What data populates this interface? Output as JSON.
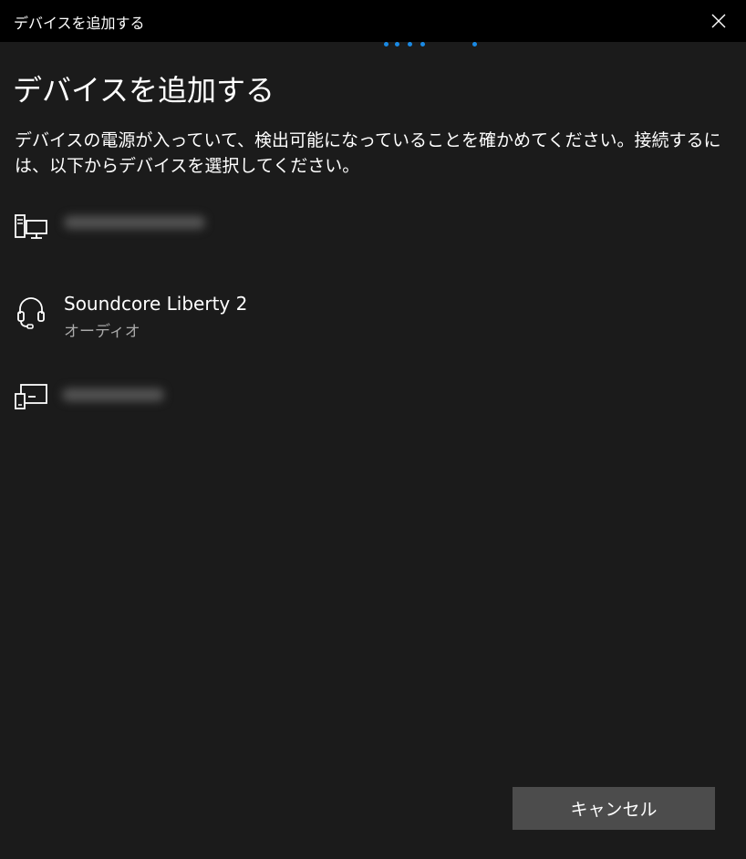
{
  "window": {
    "title": "デバイスを追加する"
  },
  "content": {
    "heading": "デバイスを追加する",
    "description": "デバイスの電源が入っていて、検出可能になっていることを確かめてください。接続するには、以下からデバイスを選択してください。"
  },
  "devices": [
    {
      "icon": "desktop-computer-icon",
      "name": "",
      "type": ""
    },
    {
      "icon": "headset-icon",
      "name": "Soundcore Liberty 2",
      "type": "オーディオ"
    },
    {
      "icon": "display-device-icon",
      "name": "",
      "type": ""
    }
  ],
  "footer": {
    "cancel_label": "キャンセル"
  },
  "colors": {
    "background": "#1b1b1b",
    "titlebar": "#000000",
    "accent": "#1a8ae5",
    "button": "#4c4c4c",
    "secondary_text": "#aaaaaa"
  }
}
